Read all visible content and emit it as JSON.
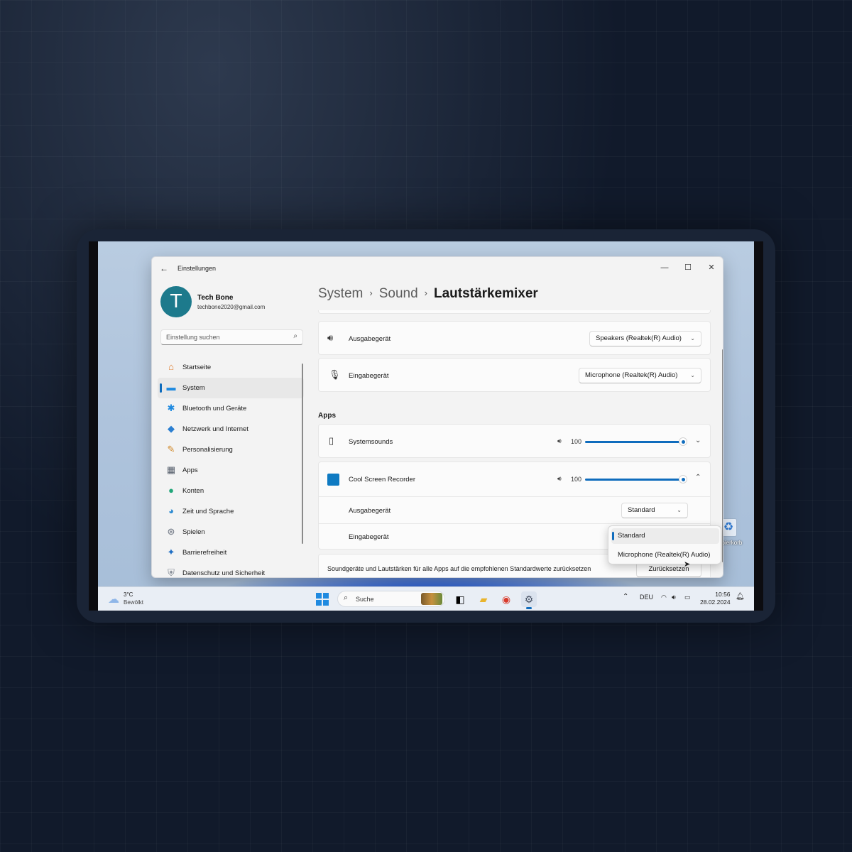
{
  "window": {
    "title": "Einstellungen",
    "controls": {
      "minimize": "—",
      "maximize": "☐",
      "close": "✕"
    }
  },
  "user": {
    "initial": "T",
    "name": "Tech Bone",
    "email": "techbone2020@gmail.com"
  },
  "search": {
    "placeholder": "Einstellung suchen"
  },
  "nav": [
    {
      "label": "Startseite",
      "icon": "home-icon",
      "glyph": "⌂",
      "color": "#e07b2b"
    },
    {
      "label": "System",
      "icon": "display-icon",
      "glyph": "▬",
      "color": "#1f8ae0",
      "selected": true
    },
    {
      "label": "Bluetooth und Geräte",
      "icon": "bluetooth-icon",
      "glyph": "✱",
      "color": "#1f8ae0"
    },
    {
      "label": "Netzwerk und Internet",
      "icon": "wifi-icon",
      "glyph": "◆",
      "color": "#2b7fd1"
    },
    {
      "label": "Personalisierung",
      "icon": "brush-icon",
      "glyph": "✎",
      "color": "#d18a2b"
    },
    {
      "label": "Apps",
      "icon": "apps-icon",
      "glyph": "▦",
      "color": "#555e6b"
    },
    {
      "label": "Konten",
      "icon": "account-icon",
      "glyph": "●",
      "color": "#21a67a"
    },
    {
      "label": "Zeit und Sprache",
      "icon": "globe-icon",
      "glyph": "◕",
      "color": "#2b8ad1"
    },
    {
      "label": "Spielen",
      "icon": "gamepad-icon",
      "glyph": "⊛",
      "color": "#6b7380"
    },
    {
      "label": "Barrierefreiheit",
      "icon": "accessibility-icon",
      "glyph": "✦",
      "color": "#1f6fc4"
    },
    {
      "label": "Datenschutz und Sicherheit",
      "icon": "shield-icon",
      "glyph": "⛨",
      "color": "#7a828c"
    }
  ],
  "breadcrumb": {
    "items": [
      "System",
      "Sound"
    ],
    "current": "Lautstärkemixer",
    "separator": "›"
  },
  "devices": {
    "output": {
      "label": "Ausgabegerät",
      "value": "Speakers (Realtek(R) Audio)"
    },
    "input": {
      "label": "Eingabegerät",
      "value": "Microphone (Realtek(R) Audio)"
    }
  },
  "apps": {
    "section_label": "Apps",
    "systemsounds": {
      "label": "Systemsounds",
      "volume": "100",
      "level": 1.0
    },
    "recorder": {
      "label": "Cool Screen Recorder",
      "volume": "100",
      "level": 1.0,
      "output_label": "Ausgabegerät",
      "output_value": "Standard",
      "input_label": "Eingabegerät"
    }
  },
  "reset": {
    "text": "Soundgeräte und Lautstärken für alle Apps auf die empfohlenen Standardwerte zurücksetzen",
    "button": "Zurücksetzen"
  },
  "popup": {
    "options": [
      "Standard",
      "Microphone (Realtek(R) Audio)"
    ],
    "selected": "Standard"
  },
  "desktop": {
    "recycle_label": "Papierkorb"
  },
  "taskbar": {
    "weather_temp": "3°C",
    "weather_desc": "Bewölkt",
    "search_label": "Suche",
    "language": "DEU",
    "time": "10:56",
    "date": "28.02.2024"
  },
  "colors": {
    "accent": "#0f6cbd"
  }
}
